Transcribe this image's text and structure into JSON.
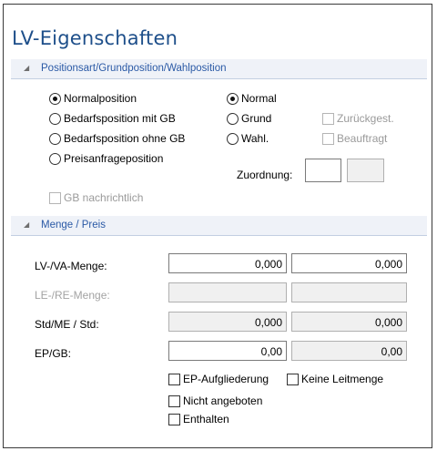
{
  "title": "LV-Eigenschaften",
  "section1": {
    "header": "Positionsart/Grundposition/Wahlposition",
    "position_types": [
      {
        "label": "Normalposition",
        "checked": true
      },
      {
        "label": "Bedarfsposition mit GB",
        "checked": false
      },
      {
        "label": "Bedarfsposition ohne GB",
        "checked": false
      },
      {
        "label": "Preisanfrageposition",
        "checked": false
      }
    ],
    "kinds": [
      {
        "label": "Normal",
        "checked": true
      },
      {
        "label": "Grund",
        "checked": false
      },
      {
        "label": "Wahl.",
        "checked": false
      }
    ],
    "zurueckgest": "Zurückgest.",
    "beauftragt": "Beauftragt",
    "zuordnung_label": "Zuordnung:",
    "gb_nachrichtlich": "GB nachrichtlich"
  },
  "section2": {
    "header": "Menge / Preis",
    "lv_va_menge": {
      "label": "LV-/VA-Menge:",
      "value1": "0,000",
      "value2": "0,000"
    },
    "le_re_menge": {
      "label": "LE-/RE-Menge:",
      "value1": "",
      "value2": ""
    },
    "std_me": {
      "label": "Std/ME / Std:",
      "value1": "0,000",
      "value2": "0,000"
    },
    "ep_gb": {
      "label": "EP/GB:",
      "value1": "0,00",
      "value2": "0,00"
    },
    "ep_aufgliederung": "EP-Aufgliederung",
    "keine_leitmenge": "Keine Leitmenge",
    "nicht_angeboten": "Nicht angeboten",
    "enthalten": "Enthalten"
  }
}
